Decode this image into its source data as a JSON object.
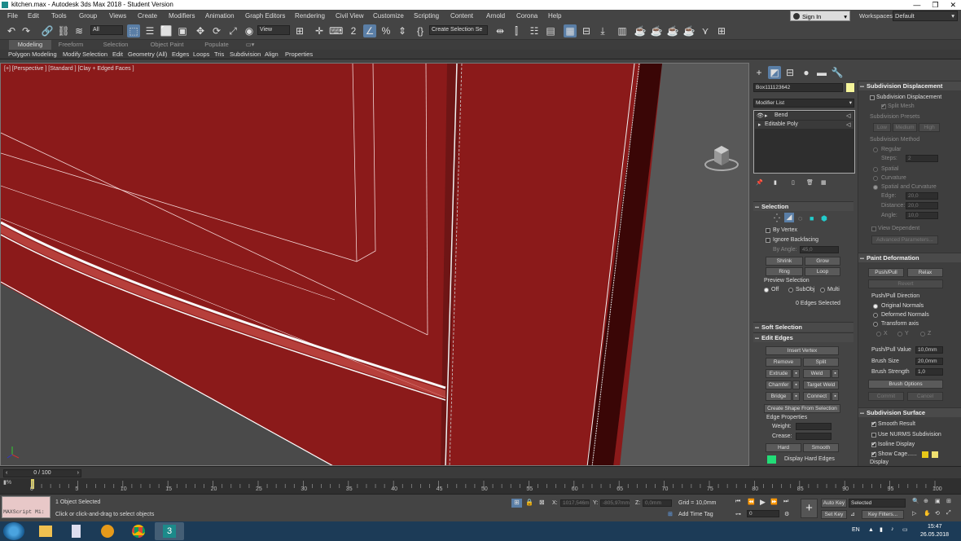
{
  "window": {
    "title": "kitchen.max - Autodesk 3ds Max 2018 - Student Version",
    "controls": [
      "—",
      "❐",
      "✕"
    ]
  },
  "menubar": {
    "items": [
      "File",
      "Edit",
      "Tools",
      "Group",
      "Views",
      "Create",
      "Modifiers",
      "Animation",
      "Graph Editors",
      "Rendering",
      "Civil View",
      "Customize",
      "Scripting",
      "Content",
      "Arnold",
      "Corona",
      "Help"
    ],
    "signin": "Sign In",
    "workspaces_label": "Workspaces:",
    "workspaces_value": "Default"
  },
  "toolbar": {
    "filter": "All",
    "refcoord": "View",
    "selset": "Create Selection Se"
  },
  "ribbon": {
    "tabs": [
      "Modeling",
      "Freeform",
      "Selection",
      "Object Paint",
      "Populate"
    ],
    "subtabs": [
      "Polygon Modeling",
      "Modify Selection",
      "Edit",
      "Geometry (All)",
      "Edges",
      "Loops",
      "Tris",
      "Subdivision",
      "Align",
      "Properties"
    ]
  },
  "viewport": {
    "label": "[+] [Perspective ] [Standard ] [Clay + Edged Faces ]"
  },
  "command_panel": {
    "object_name": "Box111123642",
    "object_color": "#f5f59a",
    "modifier_list": "Modifier List",
    "stack": [
      "Bend",
      "Editable Poly"
    ],
    "selection": {
      "title": "Selection",
      "by_vertex": "By Vertex",
      "ignore_backfacing": "Ignore Backfacing",
      "by_angle_label": "By Angle:",
      "by_angle_value": "45,0",
      "shrink": "Shrink",
      "grow": "Grow",
      "ring": "Ring",
      "loop": "Loop",
      "preview_title": "Preview Selection",
      "preview_options": [
        "Off",
        "SubObj",
        "Multi"
      ],
      "status": "0 Edges Selected"
    },
    "soft_selection": "Soft Selection",
    "edit_edges": {
      "title": "Edit Edges",
      "insert_vertex": "Insert Vertex",
      "remove": "Remove",
      "split": "Split",
      "extrude": "Extrude",
      "weld": "Weld",
      "chamfer": "Chamfer",
      "target_weld": "Target Weld",
      "bridge": "Bridge",
      "connect": "Connect",
      "create_shape": "Create Shape From Selection",
      "edge_properties": "Edge Properties",
      "weight": "Weight:",
      "crease": "Crease:",
      "hard": "Hard",
      "smooth": "Smooth",
      "display_hard_edges": "Display Hard Edges",
      "hard_edges_color": "#22dd77"
    }
  },
  "rollouts": {
    "subdivision_displacement": {
      "title": "Subdivision Displacement",
      "checkbox": "Subdivision Displacement",
      "split_mesh": "Split Mesh",
      "presets_title": "Subdivision Presets",
      "presets": [
        "Low",
        "Medium",
        "High"
      ],
      "method_title": "Subdivision Method",
      "regular": "Regular",
      "steps_label": "Steps:",
      "steps_value": "2",
      "spatial": "Spatial",
      "curvature": "Curvature",
      "spatial_curvature": "Spatial and Curvature",
      "edge_label": "Edge:",
      "edge_value": "20,0",
      "distance_label": "Distance:",
      "distance_value": "20,0",
      "angle_label": "Angle:",
      "angle_value": "10,0",
      "view_dependent": "View Dependent",
      "advanced": "Advanced Parameters..."
    },
    "paint_deformation": {
      "title": "Paint Deformation",
      "push_pull": "Push/Pull",
      "relax": "Relax",
      "revert": "Revert",
      "direction_title": "Push/Pull Direction",
      "original_normals": "Original Normals",
      "deformed_normals": "Deformed Normals",
      "transform_axis": "Transform axis",
      "axes": [
        "X",
        "Y",
        "Z"
      ],
      "push_pull_value_label": "Push/Pull Value",
      "push_pull_value": "10,0mm",
      "brush_size_label": "Brush Size",
      "brush_size": "20,0mm",
      "brush_strength_label": "Brush Strength",
      "brush_strength": "1,0",
      "brush_options": "Brush Options",
      "commit": "Commit",
      "cancel": "Cancel"
    },
    "subdivision_surface": {
      "title": "Subdivision Surface",
      "smooth_result": "Smooth Result",
      "use_nurms": "Use NURMS Subdivision",
      "isoline_display": "Isoline Display",
      "show_cage": "Show Cage......",
      "cage_color1": "#e8c818",
      "cage_color2": "#f0e070",
      "display": "Display"
    }
  },
  "timeline": {
    "frame": "0 / 100",
    "ticks": [
      "0",
      "5",
      "10",
      "15",
      "20",
      "25",
      "30",
      "35",
      "40",
      "45",
      "50",
      "55",
      "60",
      "65",
      "70",
      "75",
      "80",
      "85",
      "90",
      "95",
      "100"
    ]
  },
  "status": {
    "objects": "1 Object Selected",
    "prompt": "Click or click-and-drag to select objects",
    "maxscript": "MAXScript Mi:",
    "x_label": "X:",
    "x_value": "1017,546m",
    "y_label": "Y:",
    "y_value": "-805,97mm",
    "z_label": "Z:",
    "z_value": "0,0mm",
    "grid": "Grid = 10,0mm",
    "add_time_tag": "Add Time Tag",
    "auto_key": "Auto Key",
    "set_key": "Set Key",
    "selected": "Selected",
    "key_filters": "Key Filters...",
    "frame_value": "0"
  },
  "taskbar": {
    "lang": "EN",
    "time": "15:47",
    "date": "26.05.2018"
  }
}
